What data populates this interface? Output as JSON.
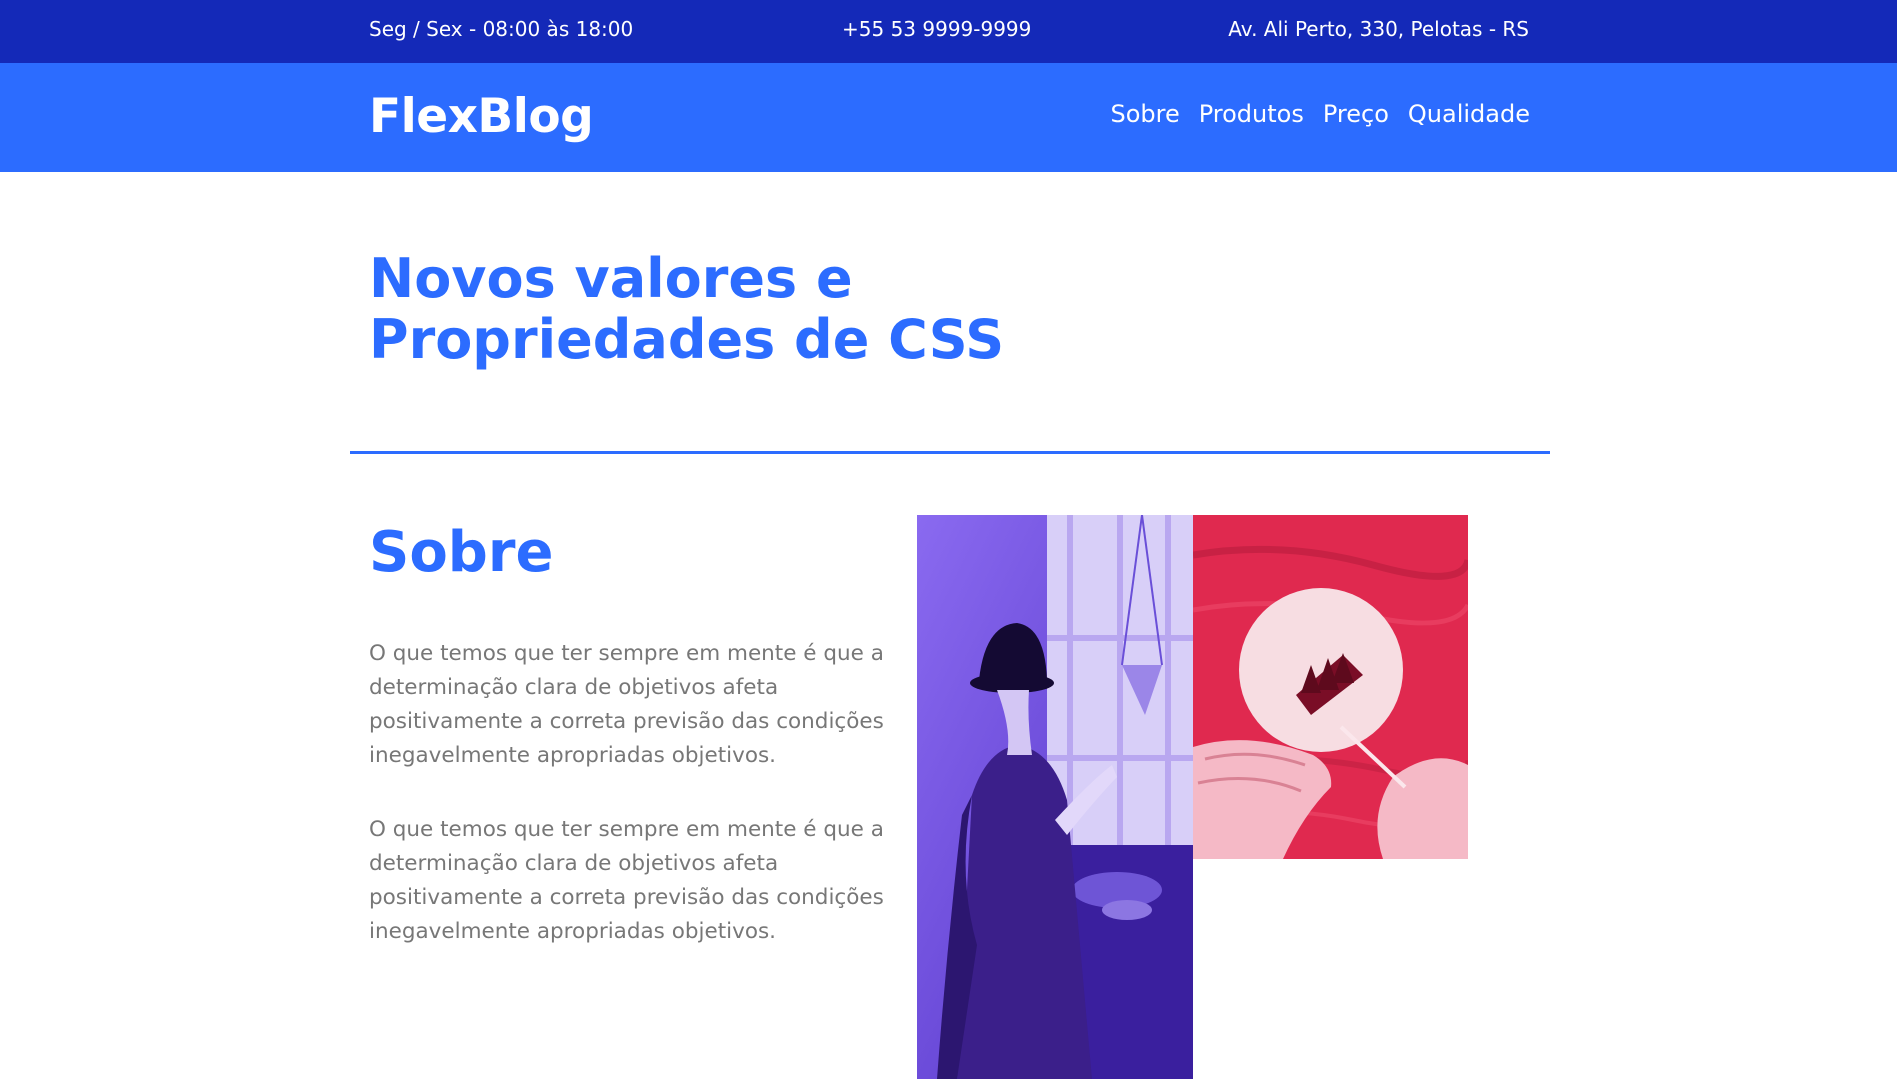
{
  "topbar": {
    "hours": "Seg / Sex - 08:00 às 18:00",
    "phone": "+55 53 9999-9999",
    "address": "Av. Ali Perto, 330, Pelotas - RS"
  },
  "navbar": {
    "logo": "FlexBlog",
    "menu": [
      "Sobre",
      "Produtos",
      "Preço",
      "Qualidade"
    ]
  },
  "hero": {
    "title_line1": "Novos valores e",
    "title_line2": "Propriedades de CSS"
  },
  "about": {
    "title": "Sobre",
    "paragraphs": [
      "O que temos que ter sempre em mente é que a determinação clara de objetivos afeta positivamente a correta previsão das condições inegavelmente apropriadas objetivos.",
      "O que temos que ter sempre em mente é que a determinação clara de objetivos afeta positivamente a correta previsão das condições inegavelmente apropriadas objetivos."
    ]
  },
  "colors": {
    "topbar": "#1429b8",
    "navbar": "#2c6cff",
    "accent": "#2c6cff",
    "body_text": "#777777"
  }
}
